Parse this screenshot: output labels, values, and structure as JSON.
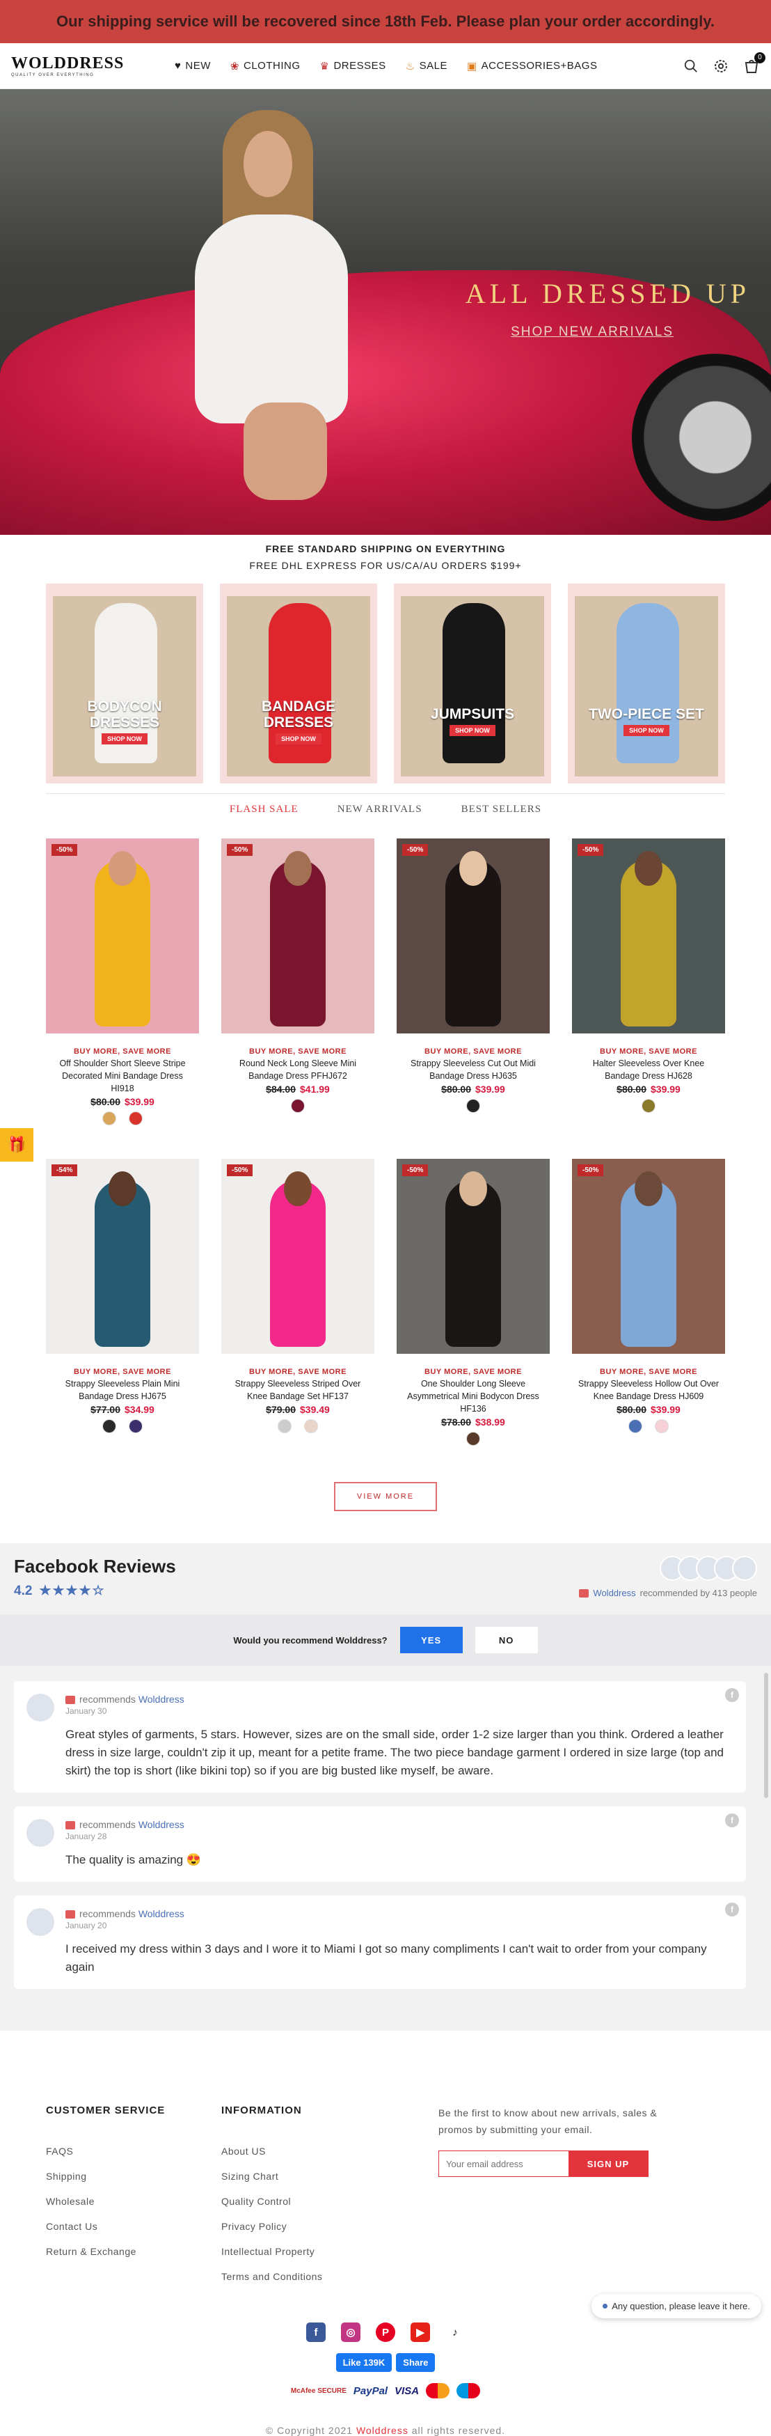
{
  "banner": {
    "text": "Our shipping service will be recovered since 18th Feb. Please plan your order accordingly."
  },
  "header": {
    "logo": "WOLDDRESS",
    "tagline": "QUALITY OVER EVERYTHING",
    "nav": [
      "NEW",
      "CLOTHING",
      "DRESSES",
      "SALE",
      "ACCESSORIES+BAGS"
    ],
    "cart_count": "0"
  },
  "hero": {
    "title": "ALL DRESSED UP",
    "link": "SHOP NEW ARRIVALS"
  },
  "shipping": {
    "line1": "FREE STANDARD SHIPPING ON EVERYTHING",
    "line2": "FREE DHL EXPRESS FOR US/CA/AU ORDERS $199+"
  },
  "categories": [
    {
      "label": "BODYCON DRESSES",
      "button": "SHOP NOW"
    },
    {
      "label": "BANDAGE DRESSES",
      "button": "SHOP NOW"
    },
    {
      "label": "JUMPSUITS",
      "button": "SHOP NOW"
    },
    {
      "label": "TWO-PIECE SET",
      "button": "SHOP NOW"
    }
  ],
  "tabs": [
    "FLASH SALE",
    "NEW ARRIVALS",
    "BEST SELLERS"
  ],
  "products": [
    {
      "badge": "-50%",
      "promo": "BUY MORE, SAVE MORE",
      "name": "Off Shoulder Short Sleeve Stripe Decorated Mini Bandage Dress HI918",
      "old": "$80.00",
      "new": "$39.99"
    },
    {
      "badge": "-50%",
      "promo": "BUY MORE, SAVE MORE",
      "name": "Round Neck Long Sleeve Mini Bandage Dress PFHJ672",
      "old": "$84.00",
      "new": "$41.99"
    },
    {
      "badge": "-50%",
      "promo": "BUY MORE, SAVE MORE",
      "name": "Strappy Sleeveless Cut Out Midi Bandage Dress HJ635",
      "old": "$80.00",
      "new": "$39.99"
    },
    {
      "badge": "-50%",
      "promo": "BUY MORE, SAVE MORE",
      "name": "Halter Sleeveless Over Knee Bandage Dress HJ628",
      "old": "$80.00",
      "new": "$39.99"
    },
    {
      "badge": "-54%",
      "promo": "BUY MORE, SAVE MORE",
      "name": "Strappy Sleeveless Plain Mini Bandage Dress HJ675",
      "old": "$77.00",
      "new": "$34.99"
    },
    {
      "badge": "-50%",
      "promo": "BUY MORE, SAVE MORE",
      "name": "Strappy Sleeveless Striped Over Knee Bandage Set HF137",
      "old": "$79.00",
      "new": "$39.49"
    },
    {
      "badge": "-50%",
      "promo": "BUY MORE, SAVE MORE",
      "name": "One Shoulder Long Sleeve Asymmetrical Mini Bodycon Dress HF136",
      "old": "$78.00",
      "new": "$38.99"
    },
    {
      "badge": "-50%",
      "promo": "BUY MORE, SAVE MORE",
      "name": "Strappy Sleeveless Hollow Out Over Knee Bandage Dress HJ609",
      "old": "$80.00",
      "new": "$39.99"
    }
  ],
  "view_more": "VIEW MORE",
  "facebook": {
    "title": "Facebook Reviews",
    "score": "4.2",
    "brand": "Wolddress",
    "recommended_text": "recommended by 413 people",
    "question": "Would you recommend Wolddress?",
    "yes": "YES",
    "no": "NO",
    "reviews": [
      {
        "label": "recommends",
        "brand": "Wolddress",
        "date": "January 30",
        "text": "Great styles of garments, 5 stars. However, sizes are on the small side, order 1-2 size larger than you think. Ordered a leather dress in size large, couldn't zip it up, meant for a petite frame. The two piece bandage garment I ordered in size large (top and skirt) the top is short (like bikini top) so if you are big busted like myself, be aware."
      },
      {
        "label": "recommends",
        "brand": "Wolddress",
        "date": "January 28",
        "text": "The quality is amazing 😍"
      },
      {
        "label": "recommends",
        "brand": "Wolddress",
        "date": "January 20",
        "text": "I received my dress within 3 days and I wore it to Miami I got so many compliments I can't wait to order from your company again"
      }
    ]
  },
  "footer": {
    "customer_service": {
      "title": "CUSTOMER SERVICE",
      "links": [
        "FAQS",
        "Shipping",
        "Wholesale",
        "Contact Us",
        "Return & Exchange"
      ]
    },
    "information": {
      "title": "INFORMATION",
      "links": [
        "About US",
        "Sizing Chart",
        "Quality Control",
        "Privacy Policy",
        "Intellectual Property",
        "Terms and Conditions"
      ]
    },
    "newsletter": {
      "text": "Be the first to know about new arrivals, sales & promos by submitting your email.",
      "placeholder": "Your email address",
      "button": "SIGN UP"
    },
    "fb_like": "Like 139K",
    "fb_share": "Share",
    "payments": [
      "McAfee SECURE",
      "PayPal",
      "VISA",
      "Mastercard",
      "Maestro"
    ],
    "copyright_prefix": "© Copyright 2021",
    "copyright_brand": "Wolddress",
    "copyright_suffix": "all rights reserved."
  },
  "chat": "Any question, please leave it here."
}
